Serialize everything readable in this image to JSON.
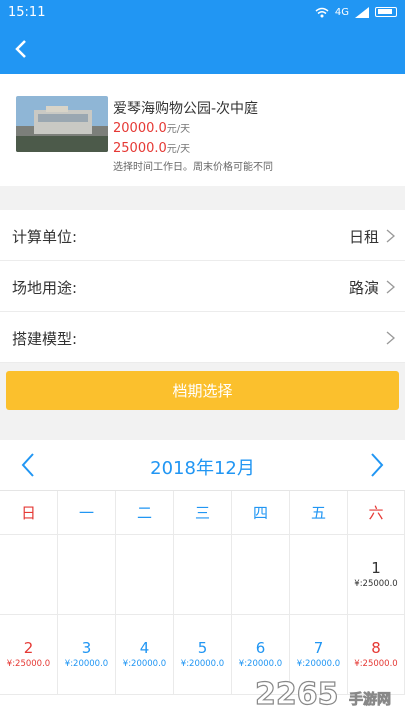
{
  "status_bar": {
    "time": "15:11",
    "network": "4G"
  },
  "venue": {
    "name": "爱琴海购物公园-次中庭",
    "price_weekday": "20000.0",
    "price_weekend": "25000.0",
    "unit": "元/天",
    "note": "选择时间工作日。周末价格可能不同"
  },
  "form": {
    "billing_label": "计算单位:",
    "billing_value": "日租",
    "purpose_label": "场地用途:",
    "purpose_value": "路演",
    "model_label": "搭建模型:",
    "model_value": ""
  },
  "schedule_button": "档期选择",
  "calendar": {
    "title": "2018年12月",
    "weekdays": [
      "日",
      "一",
      "二",
      "三",
      "四",
      "五",
      "六"
    ],
    "days": [
      {
        "day": "1",
        "price": "¥:25000.0"
      },
      {
        "day": "2",
        "price": "¥:25000.0"
      },
      {
        "day": "3",
        "price": "¥:20000.0"
      },
      {
        "day": "4",
        "price": "¥:20000.0"
      },
      {
        "day": "5",
        "price": "¥:20000.0"
      },
      {
        "day": "6",
        "price": "¥:20000.0"
      },
      {
        "day": "7",
        "price": "¥:20000.0"
      },
      {
        "day": "8",
        "price": "¥:25000.0"
      }
    ]
  },
  "watermark": {
    "text": "2265",
    "subtext": "手游网"
  },
  "colors": {
    "primary": "#2196f3",
    "accent": "#fbc02d",
    "price_red": "#e53935"
  },
  "icons": [
    "back-arrow-icon",
    "wifi-icon",
    "signal-icon",
    "battery-icon",
    "chevron-right-icon",
    "chevron-left-icon"
  ]
}
